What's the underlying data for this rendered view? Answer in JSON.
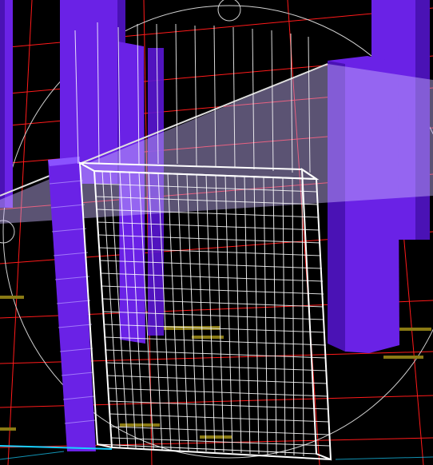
{
  "viewport": {
    "background": "#000000",
    "colors": {
      "columns": "#7a2cf0",
      "column_dark": "#4a12b5",
      "grid_lines": "#ff1a1a",
      "wireframe": "#ffffff",
      "ghost_plane": "#c9b8ff",
      "orbit_circle": "#d0d0d0",
      "highlights": "#9a8a1a",
      "base_line": "#19d0ff"
    }
  }
}
